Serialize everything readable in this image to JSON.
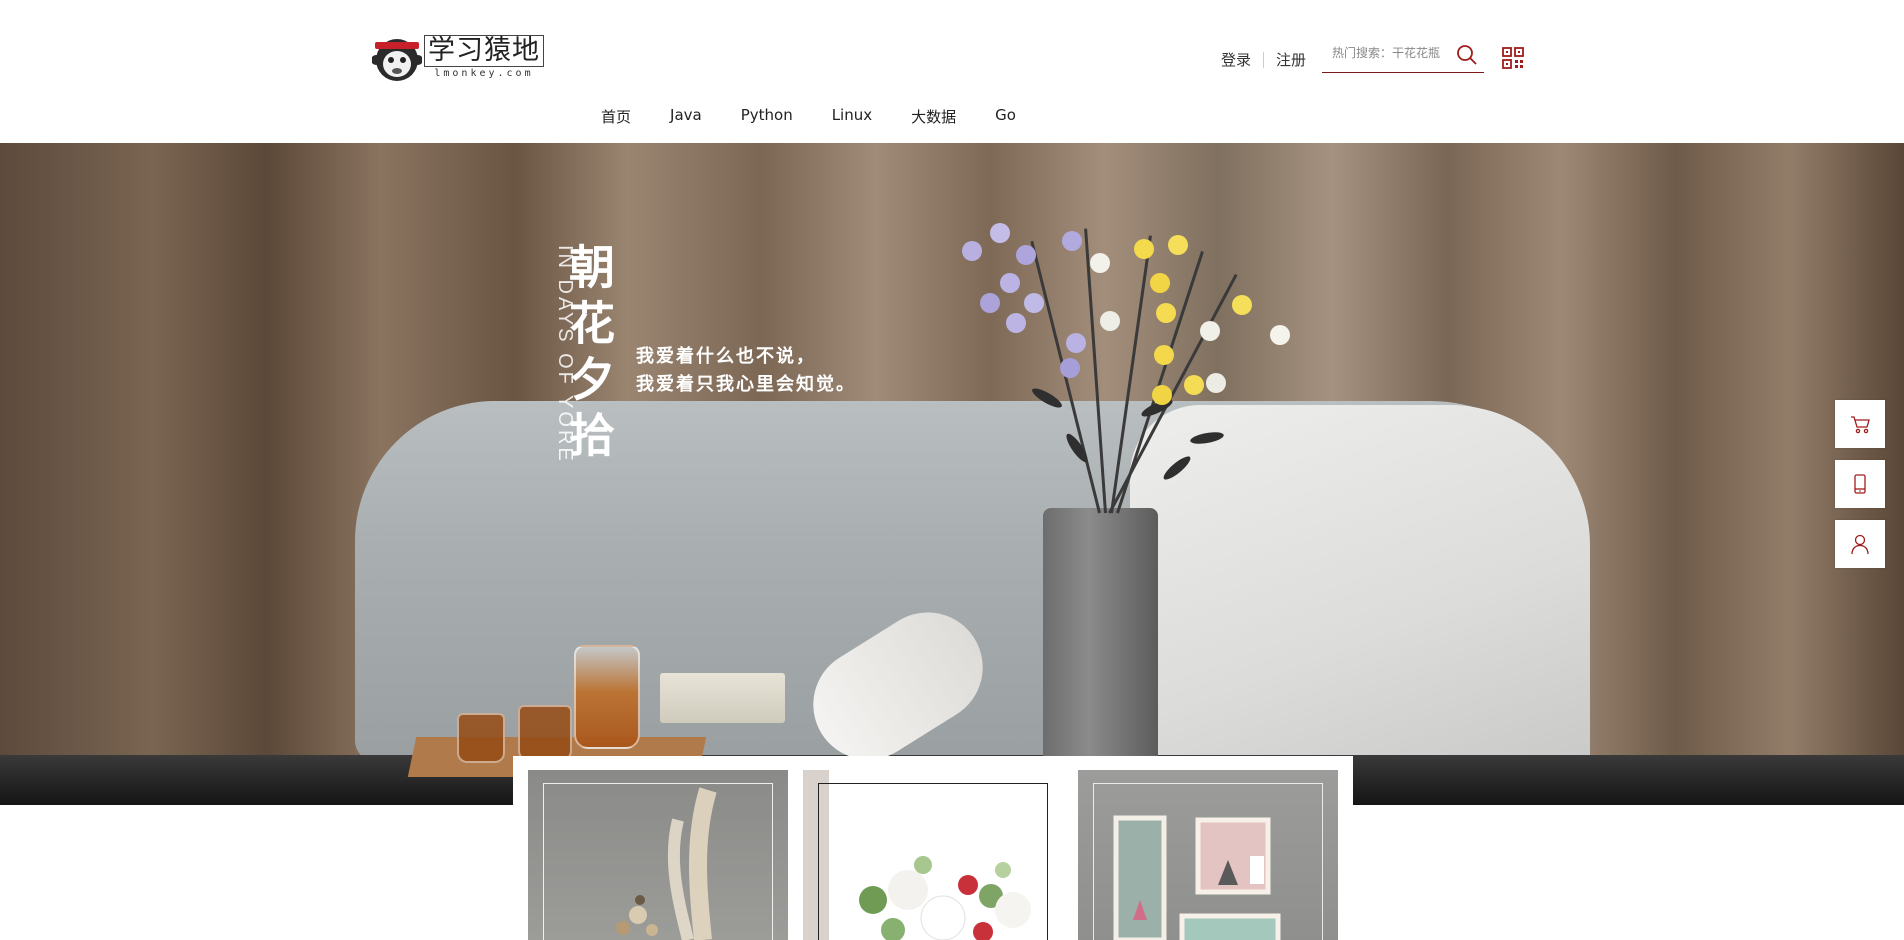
{
  "logo": {
    "cn": "学习猿地",
    "en": "lmonkey.com"
  },
  "header": {
    "login": "登录",
    "register": "注册",
    "search": {
      "placeholder": "热门搜索：干花花瓶"
    }
  },
  "nav": {
    "items": [
      "首页",
      "Java",
      "Python",
      "Linux",
      "大数据",
      "Go"
    ]
  },
  "banner": {
    "title_cn": "朝花夕拾",
    "title_en": "IN DAYS OF YORE",
    "poem": [
      "我爱着什么也不说，",
      "我爱着只我心里会知觉。"
    ]
  },
  "side": [
    "cart-icon",
    "phone-icon",
    "user-icon"
  ],
  "cards": [
    "dried-pampas-grass",
    "white-peony-bouquet",
    "wall-shelves"
  ],
  "colors": {
    "accent": "#a01c1c"
  }
}
